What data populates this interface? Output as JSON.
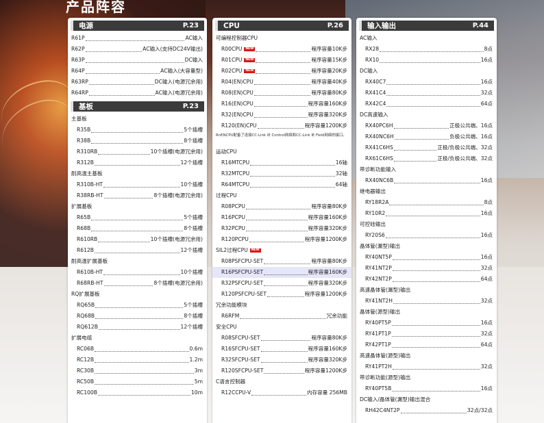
{
  "page_title": "产品阵容",
  "panels": [
    {
      "sections": [
        {
          "title": "电源",
          "page": "P.23",
          "rows": [
            {
              "t": "item",
              "n": "R61P",
              "v": "AC输入"
            },
            {
              "t": "item",
              "n": "R62P",
              "v": "AC输入(支持DC24V输出)"
            },
            {
              "t": "item",
              "n": "R63P",
              "v": "DC输入"
            },
            {
              "t": "item",
              "n": "R64P",
              "v": "AC输入(大容量型)"
            },
            {
              "t": "item",
              "n": "R63RP",
              "v": "DC输入(电源冗余用)"
            },
            {
              "t": "item",
              "n": "R64RP",
              "v": "AC输入(电源冗余用)"
            }
          ]
        },
        {
          "title": "基板",
          "page": "P.23",
          "rows": [
            {
              "t": "cat",
              "n": "主基板"
            },
            {
              "t": "sub",
              "n": "R35B",
              "v": "5个插槽"
            },
            {
              "t": "sub",
              "n": "R38B",
              "v": "8个插槽"
            },
            {
              "t": "sub",
              "n": "R310RB",
              "v": "10个插槽(电源冗余用)"
            },
            {
              "t": "sub",
              "n": "R312B",
              "v": "12个插槽"
            },
            {
              "t": "cat",
              "n": "耐高温主基板"
            },
            {
              "t": "sub",
              "n": "R310B-HT",
              "v": "10个插槽"
            },
            {
              "t": "sub",
              "n": "R38RB-HT",
              "v": "8个插槽(电源冗余用)"
            },
            {
              "t": "cat",
              "n": "扩展基板"
            },
            {
              "t": "sub",
              "n": "R65B",
              "v": "5个插槽"
            },
            {
              "t": "sub",
              "n": "R68B",
              "v": "8个插槽"
            },
            {
              "t": "sub",
              "n": "R610RB",
              "v": "10个插槽(电源冗余用)"
            },
            {
              "t": "sub",
              "n": "R612B",
              "v": "12个插槽"
            },
            {
              "t": "cat",
              "n": "耐高温扩展基板"
            },
            {
              "t": "sub",
              "n": "R610B-HT",
              "v": "10个插槽"
            },
            {
              "t": "sub",
              "n": "R68RB-HT",
              "v": "8个插槽(电源冗余用)"
            },
            {
              "t": "cat",
              "n": "RQ扩展基板"
            },
            {
              "t": "sub",
              "n": "RQ65B",
              "v": "5个插槽"
            },
            {
              "t": "sub",
              "n": "RQ68B",
              "v": "8个插槽"
            },
            {
              "t": "sub",
              "n": "RQ612B",
              "v": "12个插槽"
            },
            {
              "t": "cat",
              "n": "扩展电缆"
            },
            {
              "t": "sub",
              "n": "RC06B",
              "v": "0.6m"
            },
            {
              "t": "sub",
              "n": "RC12B",
              "v": "1.2m"
            },
            {
              "t": "sub",
              "n": "RC30B",
              "v": "3m"
            },
            {
              "t": "sub",
              "n": "RC50B",
              "v": "5m"
            },
            {
              "t": "sub",
              "n": "RC100B",
              "v": "10m"
            }
          ]
        }
      ]
    },
    {
      "sections": [
        {
          "title": "CPU",
          "page": "P.26",
          "rows": [
            {
              "t": "cat",
              "n": "可编程控制器CPU"
            },
            {
              "t": "sub",
              "n": "R00CPU",
              "v": "程序容量10K步",
              "badge": "NEW"
            },
            {
              "t": "sub",
              "n": "R01CPU",
              "v": "程序容量15K步",
              "badge": "NEW"
            },
            {
              "t": "sub",
              "n": "R02CPU",
              "v": "程序容量20K步",
              "badge": "NEW"
            },
            {
              "t": "sub",
              "n": "R04(EN)CPU",
              "v": "程序容量40K步"
            },
            {
              "t": "sub",
              "n": "R08(EN)CPU",
              "v": "程序容量80K步"
            },
            {
              "t": "sub",
              "n": "R16(EN)CPU",
              "v": "程序容量160K步"
            },
            {
              "t": "sub",
              "n": "R32(EN)CPU",
              "v": "程序容量320K步"
            },
            {
              "t": "sub",
              "n": "R120(EN)CPU",
              "v": "程序容量1200K步"
            },
            {
              "t": "note",
              "n": "RnENCPU配备了连接CC-Link IE Control网络和CC-Link IE Field网络的接口。"
            },
            {
              "t": "cat",
              "n": "运动CPU"
            },
            {
              "t": "sub",
              "n": "R16MTCPU",
              "v": "16轴"
            },
            {
              "t": "sub",
              "n": "R32MTCPU",
              "v": "32轴"
            },
            {
              "t": "sub",
              "n": "R64MTCPU",
              "v": "64轴"
            },
            {
              "t": "cat",
              "n": "过程CPU"
            },
            {
              "t": "sub",
              "n": "R08PCPU",
              "v": "程序容量80K步"
            },
            {
              "t": "sub",
              "n": "R16PCPU",
              "v": "程序容量160K步"
            },
            {
              "t": "sub",
              "n": "R32PCPU",
              "v": "程序容量320K步"
            },
            {
              "t": "sub",
              "n": "R120PCPU",
              "v": "程序容量1200K步"
            },
            {
              "t": "cat",
              "n": "SIL2过程CPU",
              "badge": "NEW"
            },
            {
              "t": "sub",
              "n": "R08PSFCPU-SET",
              "v": "程序容量80K步"
            },
            {
              "t": "sub",
              "n": "R16PSFCPU-SET",
              "v": "程序容量160K步",
              "hl": true
            },
            {
              "t": "sub",
              "n": "R32PSFCPU-SET",
              "v": "程序容量320K步"
            },
            {
              "t": "sub",
              "n": "R120PSFCPU-SET",
              "v": "程序容量1200K步"
            },
            {
              "t": "cat",
              "n": "冗余功能模块"
            },
            {
              "t": "sub",
              "n": "R6RFM",
              "v": "冗余功能"
            },
            {
              "t": "cat",
              "n": "安全CPU"
            },
            {
              "t": "sub",
              "n": "R08SFCPU-SET",
              "v": "程序容量80K步"
            },
            {
              "t": "sub",
              "n": "R16SFCPU-SET",
              "v": "程序容量160K步"
            },
            {
              "t": "sub",
              "n": "R32SFCPU-SET",
              "v": "程序容量320K步"
            },
            {
              "t": "sub",
              "n": "R120SFCPU-SET",
              "v": "程序容量1200K步"
            },
            {
              "t": "cat",
              "n": "C语言控制器"
            },
            {
              "t": "sub",
              "n": "R12CCPU-V",
              "v": "内存容量 256MB"
            }
          ]
        }
      ]
    },
    {
      "sections": [
        {
          "title": "输入输出",
          "page": "P.44",
          "rows": [
            {
              "t": "cat",
              "n": "AC输入"
            },
            {
              "t": "sub",
              "n": "RX28",
              "v": "8点"
            },
            {
              "t": "sub",
              "n": "RX10",
              "v": "16点"
            },
            {
              "t": "cat",
              "n": "DC输入"
            },
            {
              "t": "sub",
              "n": "RX40C7",
              "v": "16点"
            },
            {
              "t": "sub",
              "n": "RX41C4",
              "v": "32点"
            },
            {
              "t": "sub",
              "n": "RX42C4",
              "v": "64点"
            },
            {
              "t": "cat",
              "n": "DC高速输入"
            },
            {
              "t": "sub",
              "n": "RX40PC6H",
              "v": "正极公共端、16点"
            },
            {
              "t": "sub",
              "n": "RX40NC6H",
              "v": "负极公共端、16点"
            },
            {
              "t": "sub",
              "n": "RX41C6HS",
              "v": "正极/负极公共端、32点"
            },
            {
              "t": "sub",
              "n": "RX61C6HS",
              "v": "正极/负极公共端、32点"
            },
            {
              "t": "cat",
              "n": "带诊断功能输入"
            },
            {
              "t": "sub",
              "n": "RX40NC6B",
              "v": "16点"
            },
            {
              "t": "cat",
              "n": "继电器输出"
            },
            {
              "t": "sub",
              "n": "RY18R2A",
              "v": "8点"
            },
            {
              "t": "sub",
              "n": "RY10R2",
              "v": "16点"
            },
            {
              "t": "cat",
              "n": "可控硅输出"
            },
            {
              "t": "sub",
              "n": "RY20S6",
              "v": "16点"
            },
            {
              "t": "cat",
              "n": "晶体管(漏型)输出"
            },
            {
              "t": "sub",
              "n": "RY40NT5P",
              "v": "16点"
            },
            {
              "t": "sub",
              "n": "RY41NT2P",
              "v": "32点"
            },
            {
              "t": "sub",
              "n": "RY42NT2P",
              "v": "64点"
            },
            {
              "t": "cat",
              "n": "高速晶体管(漏型)输出"
            },
            {
              "t": "sub",
              "n": "RY41NT2H",
              "v": "32点"
            },
            {
              "t": "cat",
              "n": "晶体管(源型)输出"
            },
            {
              "t": "sub",
              "n": "RY40PT5P",
              "v": "16点"
            },
            {
              "t": "sub",
              "n": "RY41PT1P",
              "v": "32点"
            },
            {
              "t": "sub",
              "n": "RY42PT1P",
              "v": "64点"
            },
            {
              "t": "cat",
              "n": "高速晶体管(源型)输出"
            },
            {
              "t": "sub",
              "n": "RY41PT2H",
              "v": "32点"
            },
            {
              "t": "cat",
              "n": "带诊断功能(源型)输出"
            },
            {
              "t": "sub",
              "n": "RY40PT5B",
              "v": "16点"
            },
            {
              "t": "cat",
              "n": "DC输入/晶体管(漏型)输出混合"
            },
            {
              "t": "sub",
              "n": "RH42C4NT2P",
              "v": "32点/32点"
            }
          ]
        }
      ]
    }
  ]
}
